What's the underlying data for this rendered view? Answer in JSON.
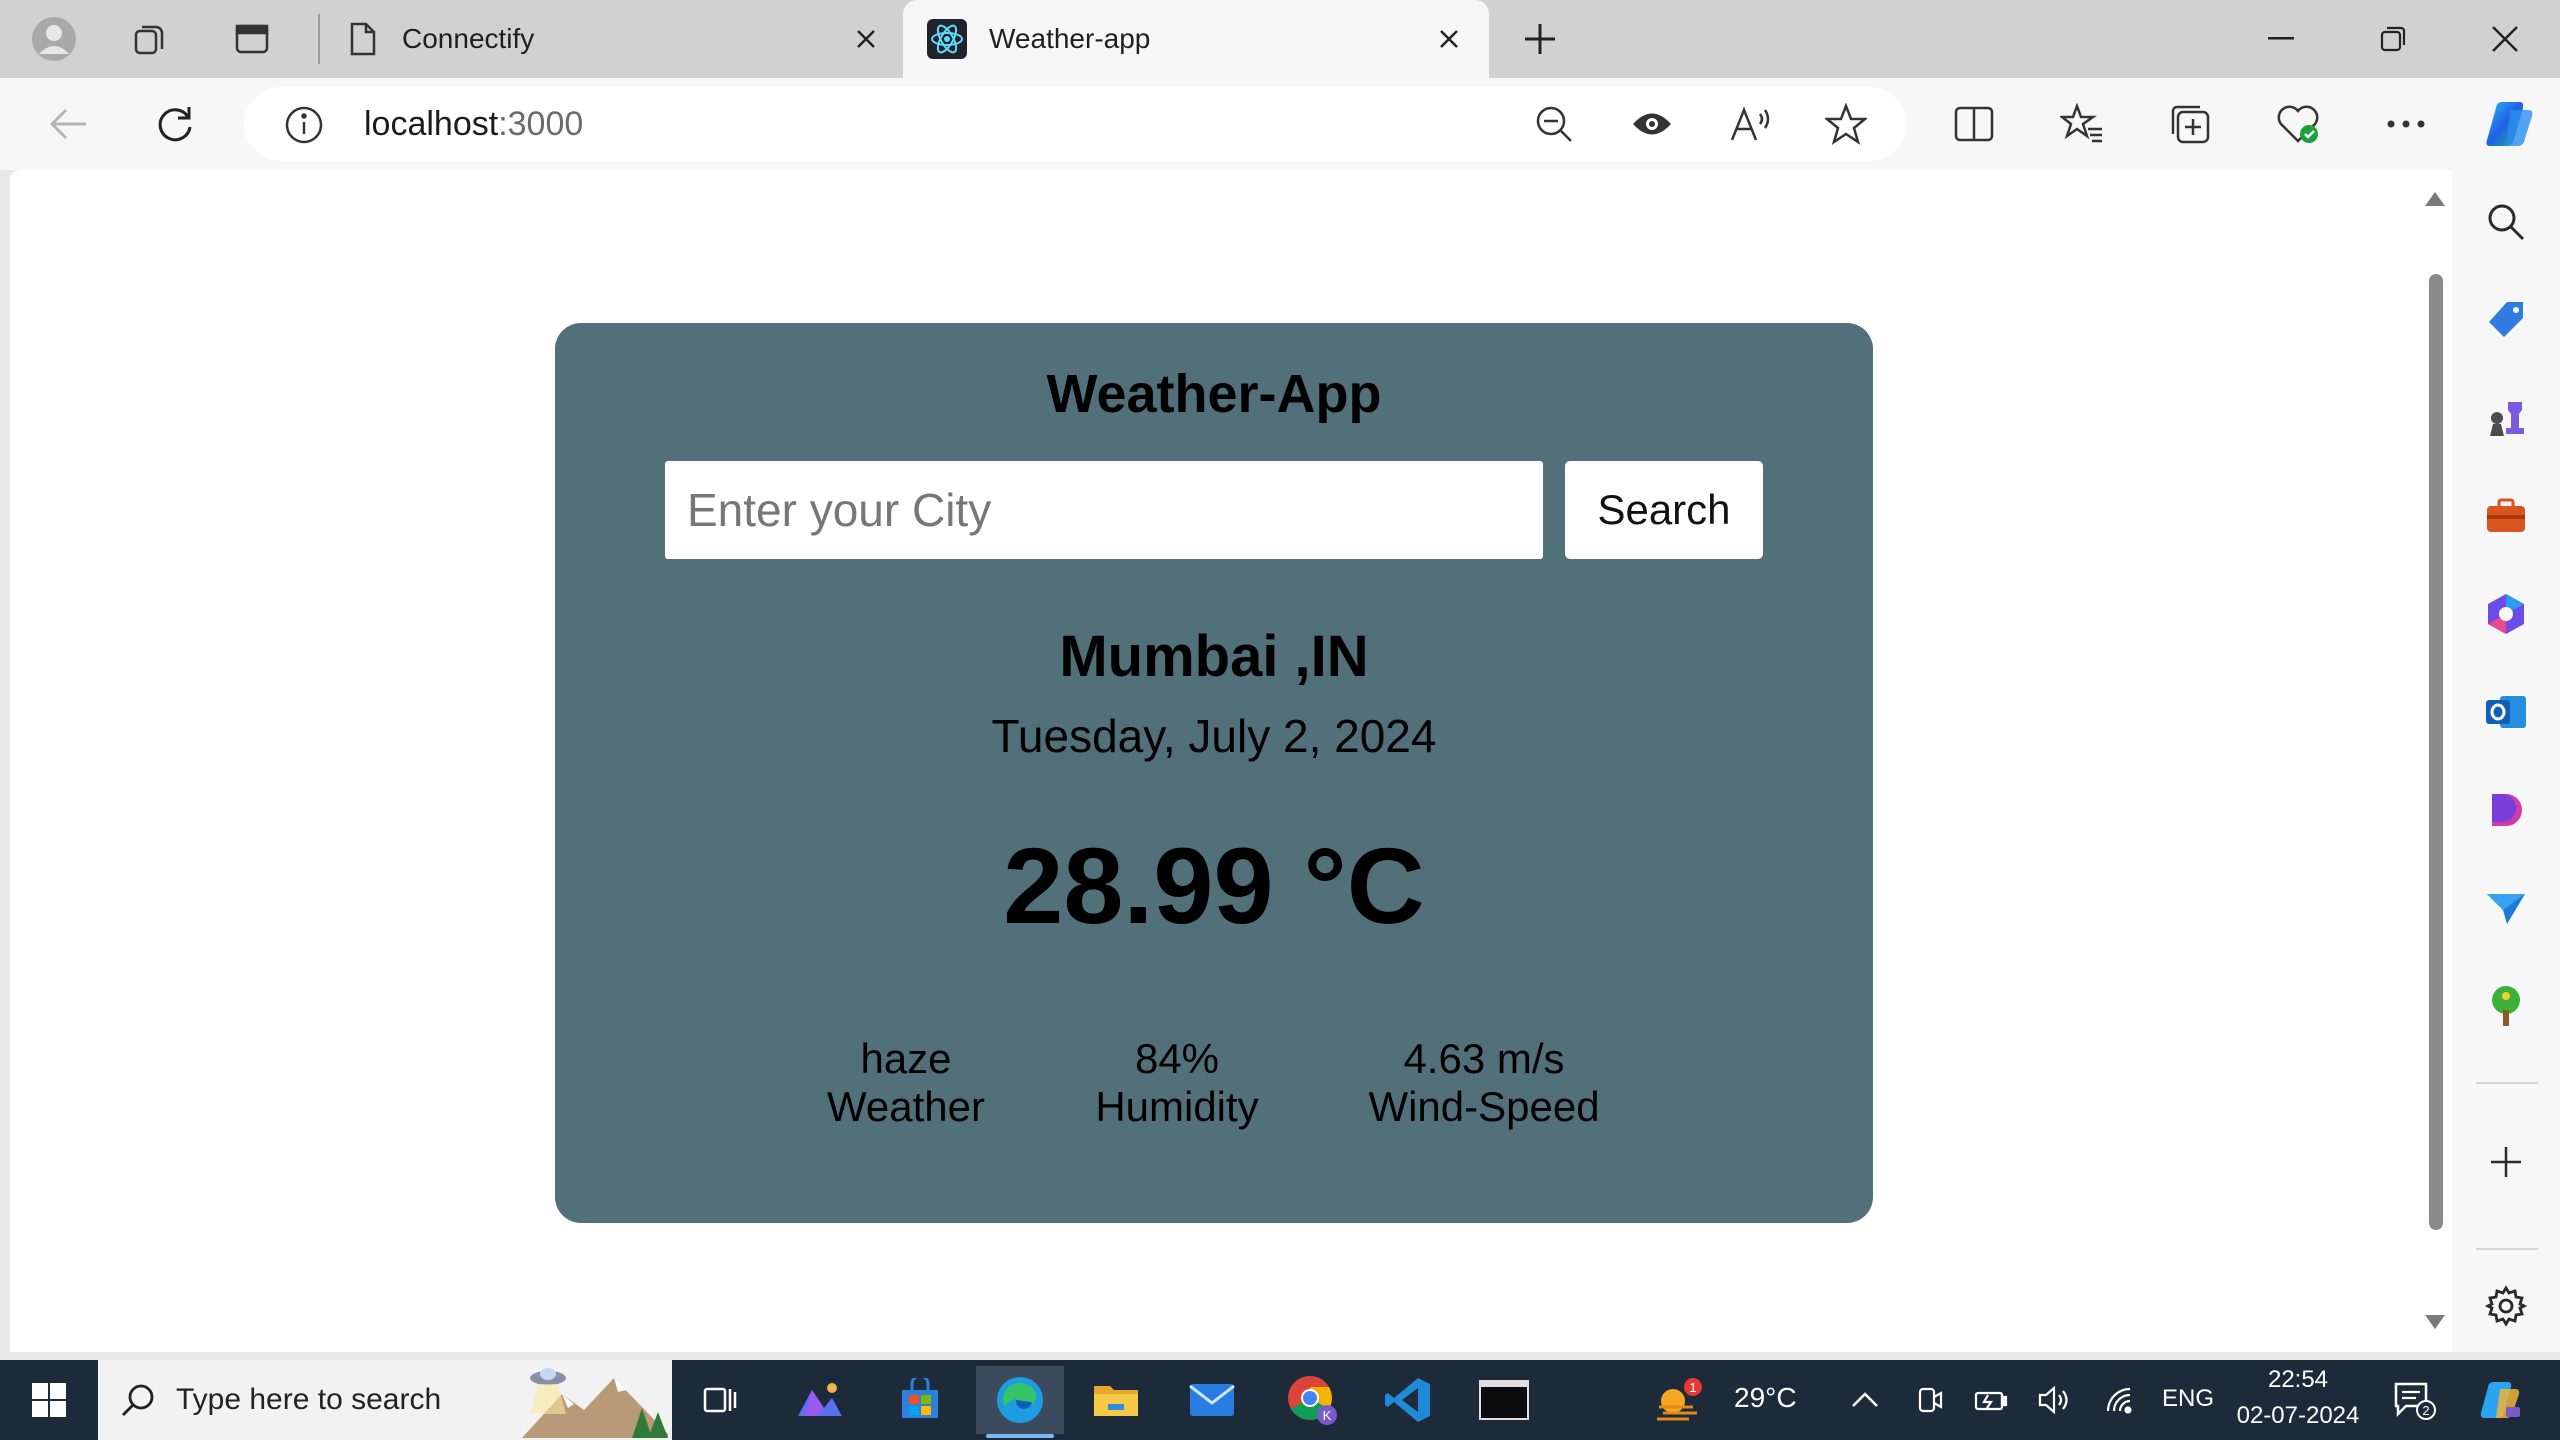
{
  "browser": {
    "tabs": [
      {
        "title": "Connectify",
        "active": false
      },
      {
        "title": "Weather-app",
        "active": true
      }
    ],
    "address": {
      "host": "localhost",
      "port": ":3000"
    }
  },
  "app": {
    "title": "Weather-App",
    "search": {
      "placeholder": "Enter your City",
      "value": "",
      "button_label": "Search"
    },
    "location": "Mumbai ,IN",
    "date": "Tuesday, July 2, 2024",
    "temperature": "28.99 °C",
    "stats": [
      {
        "value": "haze",
        "label": "Weather"
      },
      {
        "value": "84%",
        "label": "Humidity"
      },
      {
        "value": "4.63 m/s",
        "label": "Wind-Speed"
      }
    ],
    "card_color": "#52707a"
  },
  "taskbar": {
    "search_placeholder": "Type here to search",
    "weather": {
      "temp": "29°C",
      "badge": "1"
    },
    "language": "ENG",
    "clock": {
      "time": "22:54",
      "date": "02-07-2024"
    },
    "notifications": "2"
  },
  "colors": {
    "accent": "#0a84ff",
    "taskbar": "#1c2a3a"
  }
}
